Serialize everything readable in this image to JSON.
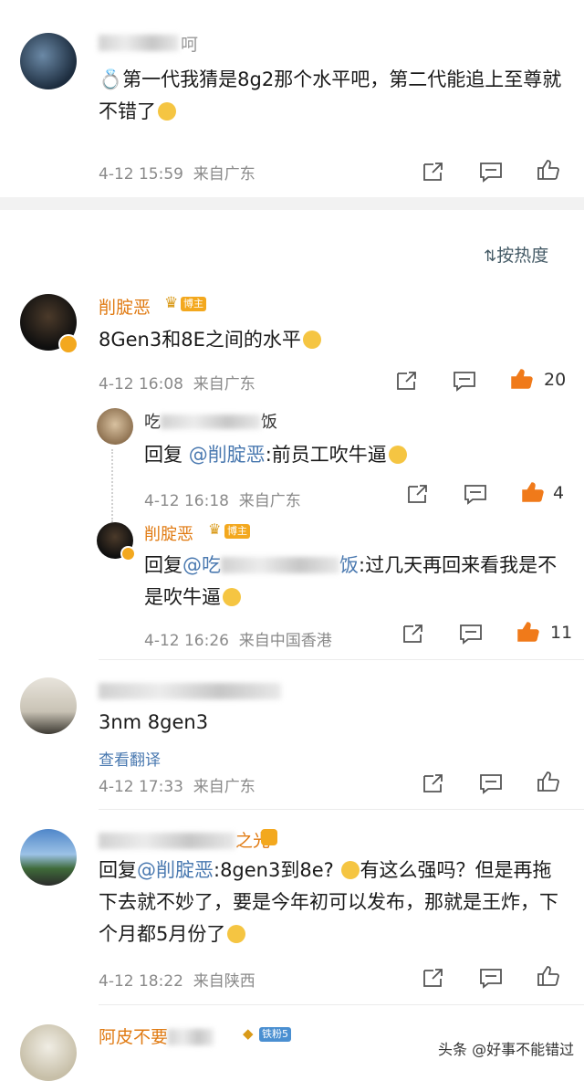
{
  "comment1": {
    "username_visible": "呵",
    "ring_emoji": "💍",
    "text": "第一代我猜是8g2那个水平吧，第二代能追上至尊就不错了",
    "time": "4-12 15:59",
    "location": "来自广东"
  },
  "sort": {
    "label": "按热度"
  },
  "comment2": {
    "username": "削腚恶",
    "badge": "博主",
    "text": "8Gen3和8E之间的水平",
    "time": "4-12 16:08",
    "location": "来自广东",
    "likes": "20",
    "replies": [
      {
        "username_visible_a": "吃",
        "username_visible_b": "饭",
        "reply_prefix": "回复",
        "mention": "@削腚恶",
        "text": ":前员工吹牛逼",
        "time": "4-12 16:18",
        "location": "来自广东",
        "likes": "4"
      },
      {
        "username": "削腚恶",
        "badge": "博主",
        "reply_prefix": "回复",
        "mention_visible": "@吃",
        "mention_tail": "饭",
        "text": ":过几天再回来看我是不是吹牛逼",
        "time": "4-12 16:26",
        "location": "来自中国香港",
        "likes": "11"
      }
    ]
  },
  "comment3": {
    "text": "3nm 8gen3",
    "translate": "查看翻译",
    "time": "4-12 17:33",
    "location": "来自广东"
  },
  "comment4": {
    "username_visible": "之光",
    "reply_prefix": "回复",
    "mention": "@削腚恶",
    "text_a": ":8gen3到8e?",
    "text_b": "有这么强吗？但是再拖下去就不妙了，要是今年初可以发布，那就是王炸，下个月都5月份了",
    "time": "4-12 18:22",
    "location": "来自陕西"
  },
  "comment5": {
    "username": "阿皮不要",
    "badge": "铁粉5"
  },
  "watermark": "头条 @好事不能错过",
  "colors": {
    "accent": "#e07a12",
    "link": "#4a79b0",
    "like_active": "#f07a1a"
  }
}
